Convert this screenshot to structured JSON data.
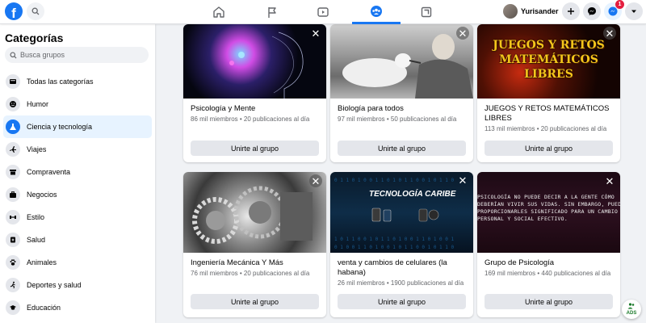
{
  "topbar": {
    "logo_letter": "f",
    "profile_name": "Yurisander",
    "notification_count": "1",
    "accent_color": "#1877f2"
  },
  "sidebar": {
    "title": "Categorías",
    "search_placeholder": "Busca grupos",
    "items": [
      {
        "label": "Todas las categorías",
        "icon": "all-categories-icon"
      },
      {
        "label": "Humor",
        "icon": "smiley-icon"
      },
      {
        "label": "Ciencia y tecnología",
        "icon": "flask-icon",
        "active": true
      },
      {
        "label": "Viajes",
        "icon": "airplane-icon"
      },
      {
        "label": "Compraventa",
        "icon": "store-icon"
      },
      {
        "label": "Negocios",
        "icon": "briefcase-icon"
      },
      {
        "label": "Estilo",
        "icon": "dumbbell-icon"
      },
      {
        "label": "Salud",
        "icon": "health-icon"
      },
      {
        "label": "Animales",
        "icon": "paw-icon"
      },
      {
        "label": "Deportes y salud",
        "icon": "running-icon"
      },
      {
        "label": "Educación",
        "icon": "graduation-cap-icon"
      }
    ]
  },
  "groups": [
    {
      "name": "Psicología y Mente",
      "meta": "86 mil miembros • 20 publicaciones al día",
      "button": "Unirte al grupo"
    },
    {
      "name": "Biología para todos",
      "meta": "97 mil miembros • 50 publicaciones al día",
      "button": "Unirte al grupo"
    },
    {
      "name": "JUEGOS Y RETOS MATEMÁTICOS LIBRES",
      "meta": "113 mil miembros • 20 publicaciones al día",
      "button": "Unirte al grupo",
      "cover_text": "JUEGOS Y RETOS MATEMÁTICOS LIBRES"
    },
    {
      "name": "Ingeniería Mecánica Y Más",
      "meta": "76 mil miembros • 20 publicaciones al día",
      "button": "Unirte al grupo"
    },
    {
      "name": "venta y cambios de celulares (la habana)",
      "meta": "26 mil miembros • 1900 publicaciones al día",
      "button": "Unirte al grupo",
      "cover_text": "TECNOLOGÍA CARIBE"
    },
    {
      "name": "Grupo de Psicología",
      "meta": "169 mil miembros • 440 publicaciones al día",
      "button": "Unirte al grupo",
      "cover_text": "PSICOLOGÍA NO PUEDE DECIR A LA GENTE CÓMO DEBERÍAN VIVIR SUS VIDAS. SIN EMBARGO, PUEDE PROPORCIONARLES SIGNIFICADO PARA UN CAMBIO PERSONAL Y SOCIAL EFECTIVO."
    }
  ],
  "ads_chip": "ADS"
}
